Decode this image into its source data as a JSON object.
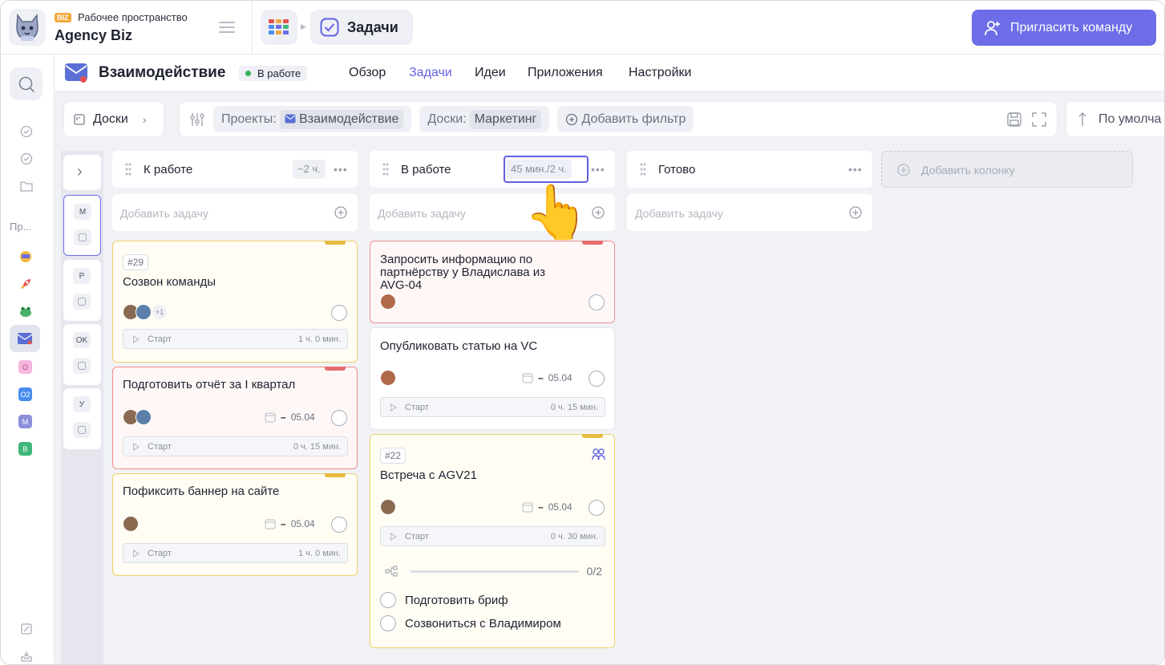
{
  "workspace": {
    "badge": "BIZ",
    "subtitle": "Рабочее пространство",
    "name": "Agency Biz"
  },
  "breadcrumb": {
    "current": "Задачи"
  },
  "invite_button": "Пригласить команду",
  "rail": {
    "projects_label": "Пр...",
    "letters": [
      "O",
      "O2",
      "M",
      "B"
    ]
  },
  "project": {
    "title": "Взаимодействие",
    "status": "В работе",
    "tabs": [
      "Обзор",
      "Задачи",
      "Идеи",
      "Приложения",
      "Настройки"
    ],
    "active_tab": "Задачи"
  },
  "filters": {
    "boards_button": "Доски",
    "projects_label": "Проекты:",
    "projects_value": "Взаимодействие",
    "boards_label": "Доски:",
    "boards_value": "Маркетинг",
    "add_filter": "Добавить фильтр",
    "sort": "По умолча"
  },
  "collapsed_boards": [
    "M",
    "P",
    "OK",
    "У"
  ],
  "columns": [
    {
      "name": "К работе",
      "estimate": "~2 ч.",
      "add_placeholder": "Добавить задачу",
      "cards": [
        {
          "tag": "#29",
          "title": "Созвон команды",
          "extra": "+1",
          "start": "Старт",
          "time": "1 ч. 0 мин."
        },
        {
          "title": "Подготовить отчёт за I квартал",
          "date": "05.04",
          "start": "Старт",
          "time": "0 ч. 15 мин."
        },
        {
          "title": "Пофиксить баннер на сайте",
          "date": "05.04",
          "start": "Старт",
          "time": "1 ч. 0 мин."
        }
      ]
    },
    {
      "name": "В работе",
      "estimate": "45 мин./2 ч.",
      "add_placeholder": "Добавить задачу",
      "cards": [
        {
          "title": "Запросить информацию по партнёрству у Владислава из AVG-04"
        },
        {
          "title": "Опубликовать статью на VC",
          "date": "05.04",
          "start": "Старт",
          "time": "0 ч. 15 мин."
        },
        {
          "tag": "#22",
          "title": "Встреча с AGV21",
          "date": "05.04",
          "start": "Старт",
          "time": "0 ч. 30 мин.",
          "progress": "0/2",
          "subtasks": [
            "Подготовить бриф",
            "Созвониться с Владимиром"
          ]
        }
      ]
    },
    {
      "name": "Готово",
      "add_placeholder": "Добавить задачу",
      "cards": []
    }
  ],
  "add_column": "Добавить колонку",
  "colors": {
    "accent": "#6d6de8",
    "yellow_flag": "#e9bb3f",
    "red_flag": "#e56b6b",
    "status_green": "#2fb45a"
  }
}
